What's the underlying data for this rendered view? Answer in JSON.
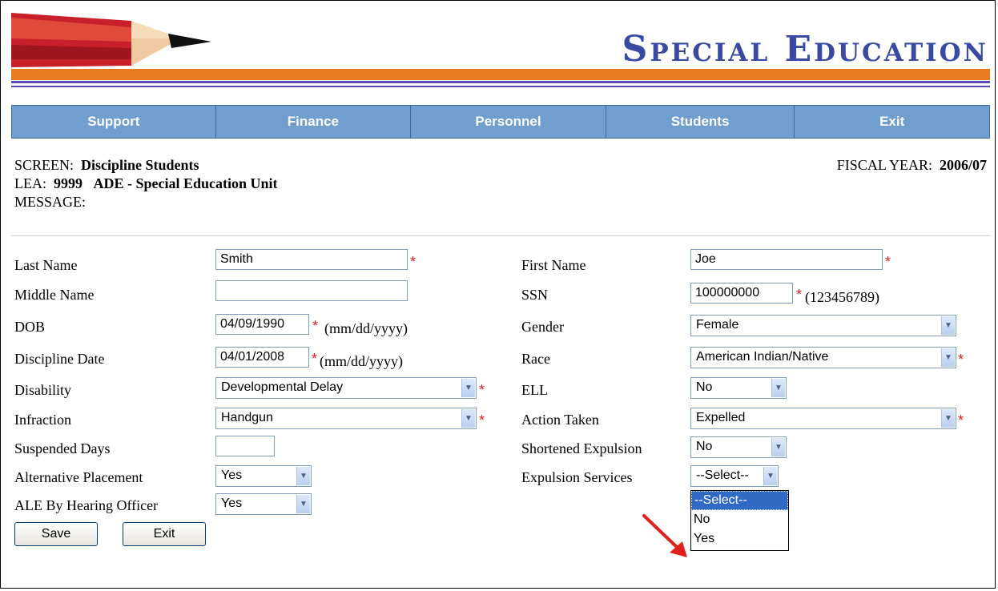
{
  "brand": {
    "title": "Special Education",
    "accent": "#3a4aa3"
  },
  "nav": [
    "Support",
    "Finance",
    "Personnel",
    "Students",
    "Exit"
  ],
  "info": {
    "screen_label": "SCREEN:",
    "screen_value": "Discipline Students",
    "fiscal_label": "FISCAL YEAR:",
    "fiscal_value": "2006/07",
    "lea_label": "LEA:",
    "lea_code": "9999",
    "lea_name": "ADE - Special Education Unit",
    "message_label": "MESSAGE:"
  },
  "form": {
    "last_name": {
      "label": "Last Name",
      "value": "Smith"
    },
    "first_name": {
      "label": "First Name",
      "value": "Joe"
    },
    "middle_name": {
      "label": "Middle Name",
      "value": ""
    },
    "ssn": {
      "label": "SSN",
      "value": "100000000",
      "hint": "(123456789)"
    },
    "dob": {
      "label": "DOB",
      "value": "04/09/1990",
      "hint": "(mm/dd/yyyy)"
    },
    "gender": {
      "label": "Gender",
      "value": "Female"
    },
    "discipline_date": {
      "label": "Discipline Date",
      "value": "04/01/2008",
      "hint": "(mm/dd/yyyy)"
    },
    "race": {
      "label": "Race",
      "value": "American Indian/Native"
    },
    "disability": {
      "label": "Disability",
      "value": "Developmental Delay"
    },
    "ell": {
      "label": "ELL",
      "value": "No"
    },
    "infraction": {
      "label": "Infraction",
      "value": "Handgun"
    },
    "action_taken": {
      "label": "Action Taken",
      "value": "Expelled"
    },
    "suspended_days": {
      "label": "Suspended Days",
      "value": ""
    },
    "shortened_expulsion": {
      "label": "Shortened Expulsion",
      "value": "No"
    },
    "alternative_placement": {
      "label": "Alternative Placement",
      "value": "Yes"
    },
    "expulsion_services": {
      "label": "Expulsion Services",
      "value": "--Select--",
      "options": [
        "--Select--",
        "No",
        "Yes"
      ]
    },
    "ale_hearing_officer": {
      "label": "ALE By Hearing Officer",
      "value": "Yes"
    },
    "required_mark": "*"
  },
  "buttons": {
    "save": "Save",
    "exit": "Exit"
  }
}
